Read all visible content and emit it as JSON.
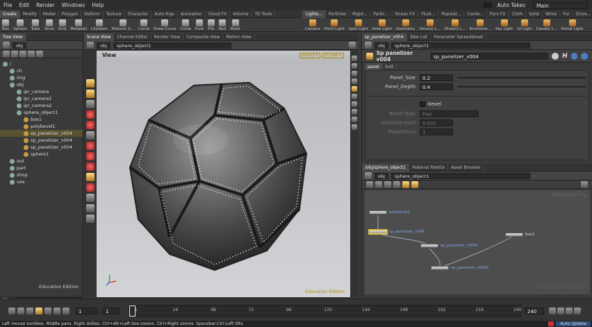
{
  "menu": [
    "File",
    "Edit",
    "Render",
    "Windows",
    "Help"
  ],
  "auto_takes": "Auto Takes",
  "desktop": "Main",
  "shelf_tabs_left": [
    "Create",
    "Modify",
    "Model",
    "Polygon",
    "Deform",
    "Texture",
    "Character",
    "Auto Rigs",
    "Animation",
    "Cloud FX",
    "Volume",
    "TD Tools"
  ],
  "shelf_tabs_right": [
    "Lights...",
    "Particles",
    "Rigid...",
    "Partic...",
    "Ocean FX",
    "Fluid...",
    "Populat...",
    "Conte...",
    "Pyro FX",
    "Cloth",
    "Solid",
    "Wires",
    "Fur",
    "Drive..."
  ],
  "shelf_tools_left": [
    "Box",
    "Sphere",
    "Tube",
    "Torus",
    "Grid",
    "Metaball",
    "LSystem",
    "Platonic S...",
    "Curve",
    "Draw Curve",
    "Circle",
    "Font",
    "File",
    "Null",
    "Rivet"
  ],
  "shelf_tools_right": [
    "Camera",
    "Point Light",
    "Spot Light",
    "Area Light",
    "Geometry",
    "Volume L...",
    "Distant L...",
    "Environm...",
    "Sky Light",
    "GI Light",
    "Caustic L...",
    "Portal Light"
  ],
  "tree": {
    "tab": "Tree View",
    "path": "obj",
    "items": [
      {
        "label": "/",
        "indent": 0
      },
      {
        "label": "ch",
        "indent": 1
      },
      {
        "label": "img",
        "indent": 1
      },
      {
        "label": "obj",
        "indent": 1
      },
      {
        "label": "ipr_camera",
        "indent": 2
      },
      {
        "label": "ipr_camera1",
        "indent": 2
      },
      {
        "label": "ipr_camera2",
        "indent": 2
      },
      {
        "label": "sphere_object1",
        "indent": 2
      },
      {
        "label": "box1",
        "indent": 3
      },
      {
        "label": "polybevel1",
        "indent": 3
      },
      {
        "label": "sp_panelizer_v004",
        "indent": 3,
        "selected": true
      },
      {
        "label": "sp_panelizer_v004",
        "indent": 3
      },
      {
        "label": "sp_panelizer_v004",
        "indent": 3
      },
      {
        "label": "sphere1",
        "indent": 3
      },
      {
        "label": "out",
        "indent": 1
      },
      {
        "label": "part",
        "indent": 1
      },
      {
        "label": "shop",
        "indent": 1
      },
      {
        "label": "vex",
        "indent": 1
      }
    ],
    "edition": "Education Edition",
    "filter_label": "Filter"
  },
  "viewer": {
    "tabs": [
      "Scene View",
      "Channel Editor",
      "Render View",
      "Composite View",
      "Motion View"
    ],
    "path_obj": "obj",
    "path_node": "sphere_object1",
    "title": "View",
    "persp": "persp1 ▾",
    "cam": "no cam ▾",
    "edition": "Education Edition"
  },
  "params": {
    "tabs": [
      "sp_panelizer_v004",
      "Take List",
      "Parameter Spreadsheet"
    ],
    "path_obj": "obj",
    "path_node": "sphere_object1",
    "node_type": "Sp panelizer v004",
    "node_name": "sp_panelizer_v004",
    "subtabs": [
      "panel",
      "bolt"
    ],
    "panel_size_label": "Panel_Size",
    "panel_size": "0.2",
    "panel_depth_label": "Panel_Depth",
    "panel_depth": "0.4",
    "bevel_label": "bevel",
    "bevel_type_label": "Bevel Type",
    "bevel_type": "Flat",
    "absolute_inset_label": "Absolute Inset",
    "absolute_inset": "0.001",
    "repetitions_label": "Repetitions",
    "repetitions": "1"
  },
  "network": {
    "tabs": [
      "/obj/sphere_object1",
      "Material Palette",
      "Asset Browser"
    ],
    "path_obj": "obj",
    "path_node": "sphere_object1",
    "watermark": "Geometry",
    "edition": "Education Edition",
    "nodes": [
      {
        "name": "polybevel1"
      },
      {
        "name": "sp_panelizer_v004",
        "selected": true
      },
      {
        "name": "sp_panelizer_v0041"
      },
      {
        "name": "box1"
      },
      {
        "name": "sp_panelizer_v0042"
      }
    ]
  },
  "timeline": {
    "frame": "1",
    "start": "1",
    "start2": "1",
    "end": "240",
    "ticks": [
      "1",
      "24",
      "48",
      "72",
      "96",
      "120",
      "144",
      "168",
      "192",
      "216",
      "240"
    ],
    "auto_update": "Auto Update"
  },
  "status": "Left mouse tumbles. Middle pans. Right dollies. Ctrl+Alt+Left box-zooms. Ctrl+Right zooms. Spacebar-Ctrl-Left tilts."
}
